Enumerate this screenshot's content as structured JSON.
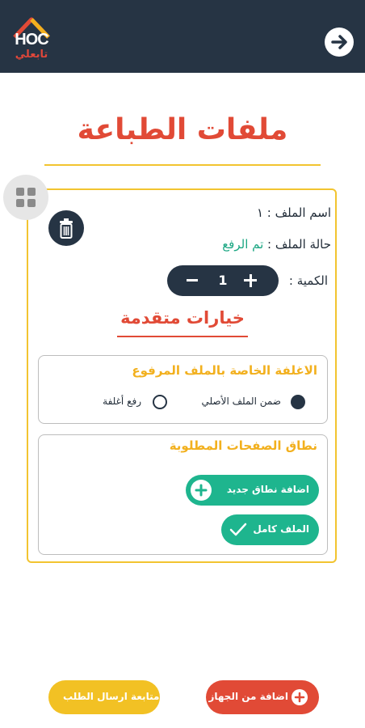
{
  "header": {
    "logo_text": "HOC",
    "logo_subtext": "تابعلي",
    "back_icon": "arrow-right-icon"
  },
  "page": {
    "title": "ملفات الطباعة"
  },
  "file_card": {
    "file_name_label": "اسم الملف : ١",
    "status_label": "حالة الملف : ",
    "status_value": "تم الرفع",
    "quantity_label": "الكمية :",
    "quantity_value": "1",
    "advanced_title": "خيارات متقدمة"
  },
  "cover_section": {
    "title": "الاغلفة الخاصة بالملف المرفوع",
    "option_selected": "ضمن الملف الأصلي",
    "option_other": "رفع أغلفة"
  },
  "range_section": {
    "title": "نطاق الصفحات المطلوبة",
    "add_range_label": "اضافة نطاق جديد",
    "full_file_label": "الملف كامل"
  },
  "footer": {
    "continue_label": "متابعة ارسال الطلب",
    "add_device_label": "اضافة من الجهاز"
  },
  "colors": {
    "header_bg": "#263444",
    "accent_red": "#e14a36",
    "accent_yellow": "#f2c430",
    "accent_green": "#1eb58e"
  }
}
